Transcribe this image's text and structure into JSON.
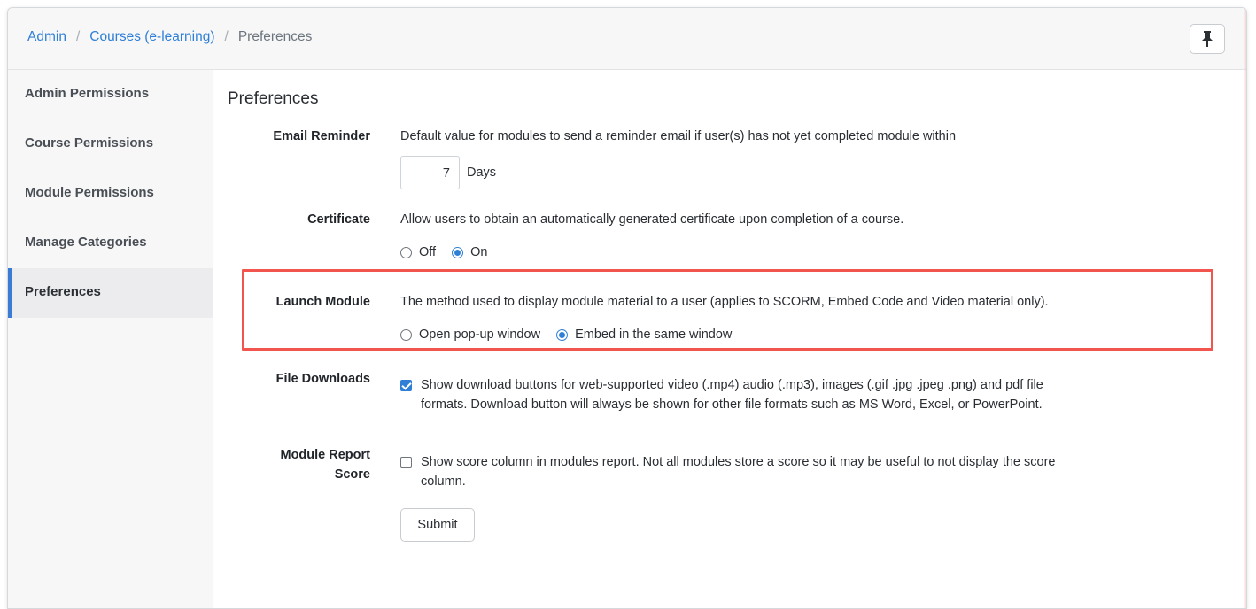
{
  "breadcrumb": {
    "items": [
      "Admin",
      "Courses (e-learning)"
    ],
    "current": "Preferences",
    "separator": "/"
  },
  "toolbar": {
    "pin_icon": "pushpin-icon"
  },
  "sidebar": {
    "items": [
      {
        "label": "Admin Permissions",
        "active": false
      },
      {
        "label": "Course Permissions",
        "active": false
      },
      {
        "label": "Module Permissions",
        "active": false
      },
      {
        "label": "Manage Categories",
        "active": false
      },
      {
        "label": "Preferences",
        "active": true
      }
    ]
  },
  "page": {
    "title": "Preferences",
    "email_reminder": {
      "label": "Email Reminder",
      "description": "Default value for modules to send a reminder email if user(s) has not yet completed module within",
      "value": "7",
      "unit": "Days"
    },
    "certificate": {
      "label": "Certificate",
      "description": "Allow users to obtain an automatically generated certificate upon completion of a course.",
      "options": [
        {
          "label": "Off",
          "checked": false
        },
        {
          "label": "On",
          "checked": true
        }
      ]
    },
    "launch_module": {
      "label": "Launch Module",
      "description": "The method used to display module material to a user (applies to SCORM, Embed Code and Video material only).",
      "options": [
        {
          "label": "Open pop-up window",
          "checked": false
        },
        {
          "label": "Embed in the same window",
          "checked": true
        }
      ]
    },
    "file_downloads": {
      "label": "File Downloads",
      "checked": true,
      "text_line1": "Show download buttons for web-supported video (.mp4) audio (.mp3), images (.gif .jpg .jpeg .png) and pdf file",
      "text_line2": "formats. Download button will always be shown for other file formats such as MS Word, Excel, or PowerPoint."
    },
    "module_report_score": {
      "label_line1": "Module Report",
      "label_line2": "Score",
      "checked": false,
      "text_line1": "Show score column in modules report. Not all modules store a score so it may be useful to not display the score",
      "text_line2": "column."
    },
    "submit_label": "Submit"
  },
  "colors": {
    "accent": "#2f7fd6",
    "highlight_border": "#f2554d",
    "sidebar_bg": "#f7f7f8"
  }
}
